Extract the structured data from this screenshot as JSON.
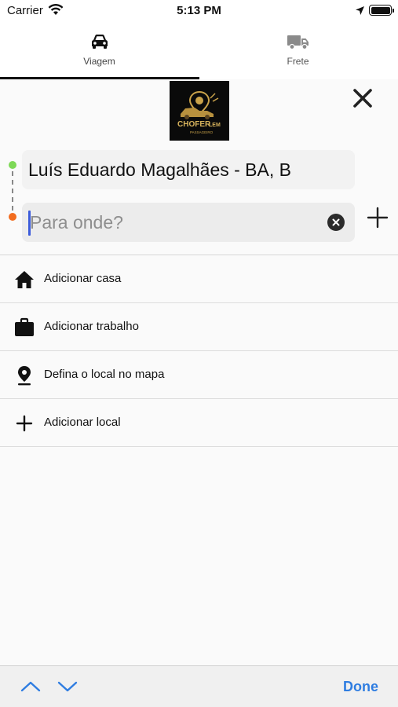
{
  "status_bar": {
    "carrier": "Carrier",
    "time": "5:13 PM"
  },
  "tabs": [
    {
      "label": "Viagem",
      "icon": "car-icon",
      "active": true
    },
    {
      "label": "Frete",
      "icon": "truck-icon",
      "active": false
    }
  ],
  "logo": {
    "brand_text": "CHOFER LEM",
    "tagline": "PASSAGEIRO"
  },
  "route": {
    "origin_value": "Luís Eduardo Magalhães - BA, B",
    "destination_value": "",
    "destination_placeholder": "Para onde?",
    "origin_dot_color": "#7ed957",
    "destination_dot_color": "#f26c1f"
  },
  "list": [
    {
      "label": "Adicionar casa",
      "icon": "home-icon"
    },
    {
      "label": "Adicionar trabalho",
      "icon": "briefcase-icon"
    },
    {
      "label": "Defina o local no mapa",
      "icon": "map-pin-icon"
    },
    {
      "label": "Adicionar local",
      "icon": "plus-icon"
    }
  ],
  "accessory": {
    "done_label": "Done",
    "accent_color": "#2f7de1"
  }
}
